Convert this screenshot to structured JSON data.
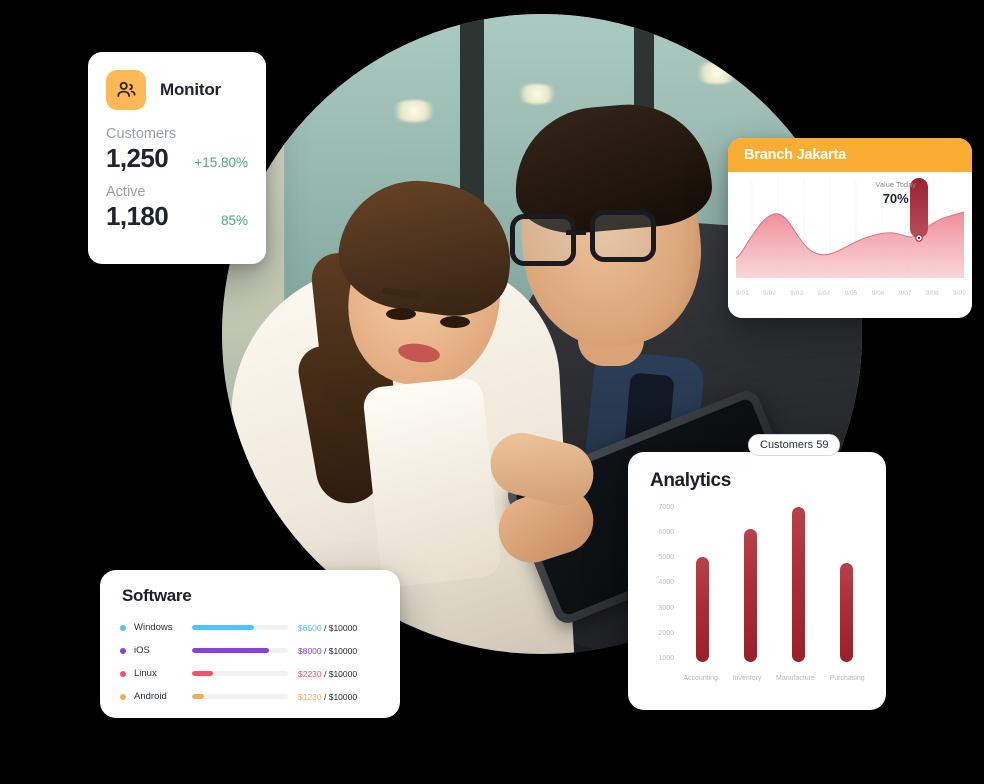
{
  "monitor_card": {
    "icon": "users-icon",
    "title": "Monitor",
    "accent_color": "#FCB956",
    "metrics": [
      {
        "label": "Customers",
        "value": "1,250",
        "delta": "+15.80%"
      },
      {
        "label": "Active",
        "value": "1,180",
        "delta": "85%"
      }
    ],
    "delta_color": "#4FA971"
  },
  "branch_card": {
    "title": "Branch Jakarta",
    "header_color": "#F9AE33",
    "tooltip_label": "Value Today",
    "tooltip_value": "70%",
    "badge": "Customers 59",
    "chart_data": {
      "type": "area",
      "title": "Branch Jakarta",
      "x": [
        "9/01",
        "9/02",
        "9/03",
        "9/04",
        "9/05",
        "9/06",
        "9/07",
        "9/08",
        "9/09"
      ],
      "values": [
        28,
        62,
        40,
        22,
        30,
        44,
        50,
        46,
        58
      ],
      "ylim": [
        0,
        100
      ],
      "xlabel": "",
      "ylabel": "",
      "grid": true,
      "legend": "none",
      "series_color": "#E8808A",
      "highlight": {
        "x": "9/08",
        "label": "Value Today",
        "value": "70%"
      }
    }
  },
  "analytics_card": {
    "title": "Analytics",
    "chart_data": {
      "type": "bar",
      "title": "Analytics",
      "categories": [
        "Accounting",
        "Inventory",
        "Manufacture",
        "Purchasing"
      ],
      "values": [
        5000,
        6050,
        6900,
        4750
      ],
      "yticks": [
        "7000",
        "6000",
        "5000",
        "4000",
        "3000",
        "2000",
        "1000"
      ],
      "ylim": [
        1000,
        7000
      ],
      "xlabel": "",
      "ylabel": "",
      "grid": false,
      "legend": "none",
      "bar_color": "#A8303C"
    }
  },
  "software_card": {
    "title": "Software",
    "total": "$10000",
    "chart_data": {
      "type": "bar",
      "title": "Software",
      "categories": [
        "Windows",
        "iOS",
        "Linux",
        "Android"
      ],
      "values": [
        6500,
        8000,
        2230,
        1230
      ],
      "max": 10000,
      "xlabel": "",
      "ylabel": "",
      "legend": "none"
    },
    "rows": [
      {
        "name": "Windows",
        "color": "#4EC3F7",
        "value": "$6500",
        "total": "/ $10000",
        "percent": 65
      },
      {
        "name": "iOS",
        "color": "#8A3FE0",
        "value": "$8000",
        "total": "/ $10000",
        "percent": 80
      },
      {
        "name": "Linux",
        "color": "#F4516C",
        "value": "$2230",
        "total": "/ $10000",
        "percent": 22.3
      },
      {
        "name": "Android",
        "color": "#F3AE55",
        "value": "$1230",
        "total": "/ $10000",
        "percent": 12.3
      }
    ]
  }
}
